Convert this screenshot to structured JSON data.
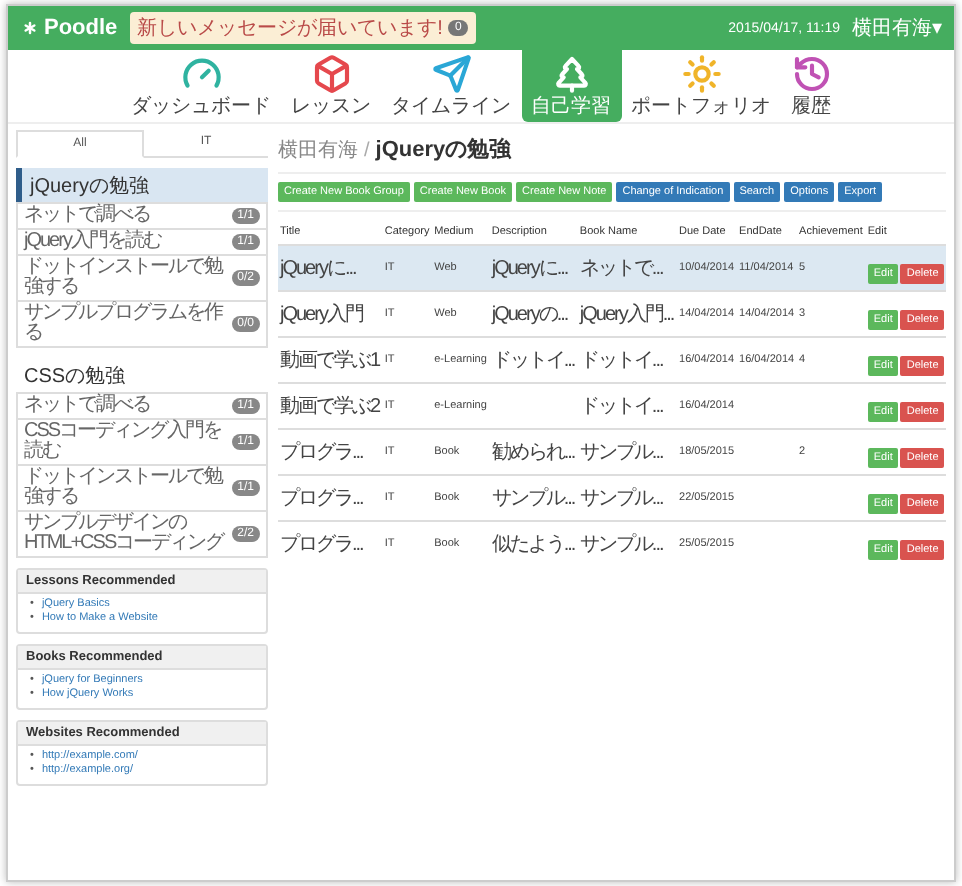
{
  "header": {
    "logo": "Poodle",
    "notice": {
      "text": "新しいメッセージが届いています!",
      "count": "0"
    },
    "datetime": "2015/04/17, 11:19",
    "user": "横田有海▾"
  },
  "nav": [
    {
      "label": "ダッシュボード",
      "kind": "gauge",
      "selected": false
    },
    {
      "label": "レッスン",
      "kind": "cube",
      "selected": false
    },
    {
      "label": "タイムライン",
      "kind": "plane",
      "selected": false
    },
    {
      "label": "自己学習",
      "kind": "tree",
      "selected": true
    },
    {
      "label": "ポートフォリオ",
      "kind": "sun",
      "selected": false
    },
    {
      "label": "履歴",
      "kind": "history",
      "selected": false
    }
  ],
  "sidebar": {
    "tabs": [
      {
        "label": "All",
        "selected": true
      },
      {
        "label": "IT",
        "selected": false
      }
    ],
    "groups": [
      {
        "title": "jQueryの勉強",
        "selected": true,
        "items": [
          {
            "label": "ネットで調べる",
            "count": "1/1"
          },
          {
            "label": "jQuery入門を読む",
            "count": "1/1"
          },
          {
            "label": "ドットインストールで勉強する",
            "count": "0/2"
          },
          {
            "label": "サンプルプログラムを作る",
            "count": "0/0"
          }
        ]
      },
      {
        "title": "CSSの勉強",
        "selected": false,
        "items": [
          {
            "label": "ネットで調べる",
            "count": "1/1"
          },
          {
            "label": "CSSコーディング入門を読む",
            "count": "1/1"
          },
          {
            "label": "ドットインストールで勉強する",
            "count": "1/1"
          },
          {
            "label": "サンプルデザインのHTML+CSSコーディング",
            "count": "2/2"
          }
        ]
      }
    ],
    "cards": [
      {
        "title": "Lessons Recommended",
        "links": [
          {
            "marker": "•",
            "text": "jQuery Basics"
          },
          {
            "marker": "•",
            "text": "How to Make a Website"
          }
        ]
      },
      {
        "title": "Books Recommended",
        "links": [
          {
            "marker": "•",
            "text": "jQuery for Beginners"
          },
          {
            "marker": "•",
            "text": "How jQuery Works"
          }
        ]
      },
      {
        "title": "Websites Recommended",
        "links": [
          {
            "marker": "•",
            "text": "http://example.com/"
          },
          {
            "marker": "•",
            "text": "http://example.org/"
          }
        ]
      }
    ]
  },
  "main": {
    "breadcrumb": {
      "parent": "横田有海",
      "separator": "/",
      "current": "jQueryの勉強"
    },
    "toolbar": [
      {
        "label": "Create New Book Group",
        "kind": "success"
      },
      {
        "label": "Create New Book",
        "kind": "success"
      },
      {
        "label": "Create New Note",
        "kind": "success"
      },
      {
        "label": "Change of Indication",
        "kind": "primary"
      },
      {
        "label": "Search",
        "kind": "primary"
      },
      {
        "label": "Options",
        "kind": "primary"
      },
      {
        "label": "Export",
        "kind": "primary"
      }
    ],
    "table": {
      "columns": [
        "Title",
        "Category",
        "Medium",
        "Description",
        "Book Name",
        "Due Date",
        "EndDate",
        "Achievement",
        "Edit"
      ],
      "rows": [
        {
          "selected": true,
          "cells": [
            "jQueryに...",
            "IT",
            "Web",
            "jQueryに...",
            "ネットで...",
            "10/04/2014",
            "11/04/2014",
            "5"
          ],
          "actions": [
            "Edit",
            "Delete"
          ]
        },
        {
          "selected": false,
          "cells": [
            "jQuery入門",
            "IT",
            "Web",
            "jQueryの...",
            "jQuery入門...",
            "14/04/2014",
            "14/04/2014",
            "3"
          ],
          "actions": [
            "Edit",
            "Delete"
          ]
        },
        {
          "selected": false,
          "cells": [
            "動画で学ぶ1",
            "IT",
            "e-Learning",
            "ドットイ...",
            "ドットイ...",
            "16/04/2014",
            "16/04/2014",
            "4"
          ],
          "actions": [
            "Edit",
            "Delete"
          ]
        },
        {
          "selected": false,
          "cells": [
            "動画で学ぶ2",
            "IT",
            "e-Learning",
            null,
            "ドットイ...",
            "16/04/2014",
            null,
            null
          ],
          "actions": [
            "Edit",
            "Delete"
          ]
        },
        {
          "selected": false,
          "cells": [
            "プログラ...",
            "IT",
            "Book",
            "勧められ...",
            "サンプル...",
            "18/05/2015",
            null,
            "2"
          ],
          "actions": [
            "Edit",
            "Delete"
          ]
        },
        {
          "selected": false,
          "cells": [
            "プログラ...",
            "IT",
            "Book",
            "サンプル...",
            "サンプル...",
            "22/05/2015",
            null,
            null
          ],
          "actions": [
            "Edit",
            "Delete"
          ]
        },
        {
          "selected": false,
          "cells": [
            "プログラ...",
            "IT",
            "Book",
            "似たよう...",
            "サンプル...",
            "25/05/2015",
            null,
            null
          ],
          "actions": [
            "Edit",
            "Delete"
          ]
        }
      ]
    }
  }
}
